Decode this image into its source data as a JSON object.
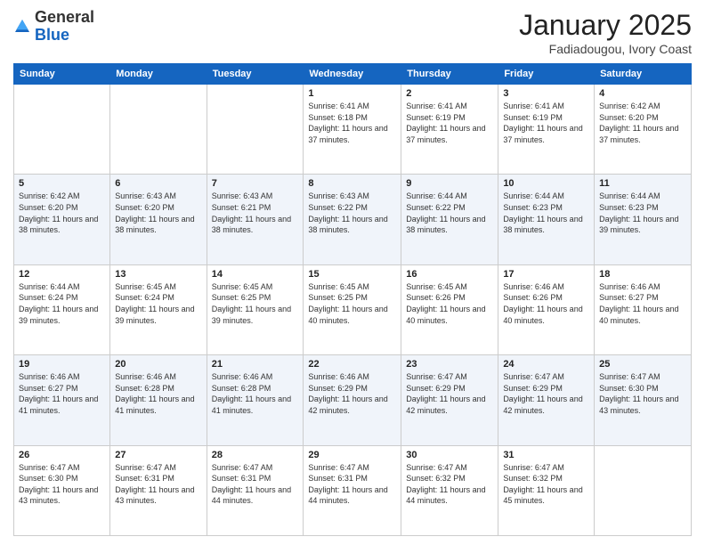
{
  "header": {
    "logo_general": "General",
    "logo_blue": "Blue",
    "month_title": "January 2025",
    "subtitle": "Fadiadougou, Ivory Coast"
  },
  "weekdays": [
    "Sunday",
    "Monday",
    "Tuesday",
    "Wednesday",
    "Thursday",
    "Friday",
    "Saturday"
  ],
  "weeks": [
    [
      {
        "day": "",
        "sunrise": "",
        "sunset": "",
        "daylight": ""
      },
      {
        "day": "",
        "sunrise": "",
        "sunset": "",
        "daylight": ""
      },
      {
        "day": "",
        "sunrise": "",
        "sunset": "",
        "daylight": ""
      },
      {
        "day": "1",
        "sunrise": "Sunrise: 6:41 AM",
        "sunset": "Sunset: 6:18 PM",
        "daylight": "Daylight: 11 hours and 37 minutes."
      },
      {
        "day": "2",
        "sunrise": "Sunrise: 6:41 AM",
        "sunset": "Sunset: 6:19 PM",
        "daylight": "Daylight: 11 hours and 37 minutes."
      },
      {
        "day": "3",
        "sunrise": "Sunrise: 6:41 AM",
        "sunset": "Sunset: 6:19 PM",
        "daylight": "Daylight: 11 hours and 37 minutes."
      },
      {
        "day": "4",
        "sunrise": "Sunrise: 6:42 AM",
        "sunset": "Sunset: 6:20 PM",
        "daylight": "Daylight: 11 hours and 37 minutes."
      }
    ],
    [
      {
        "day": "5",
        "sunrise": "Sunrise: 6:42 AM",
        "sunset": "Sunset: 6:20 PM",
        "daylight": "Daylight: 11 hours and 38 minutes."
      },
      {
        "day": "6",
        "sunrise": "Sunrise: 6:43 AM",
        "sunset": "Sunset: 6:20 PM",
        "daylight": "Daylight: 11 hours and 38 minutes."
      },
      {
        "day": "7",
        "sunrise": "Sunrise: 6:43 AM",
        "sunset": "Sunset: 6:21 PM",
        "daylight": "Daylight: 11 hours and 38 minutes."
      },
      {
        "day": "8",
        "sunrise": "Sunrise: 6:43 AM",
        "sunset": "Sunset: 6:22 PM",
        "daylight": "Daylight: 11 hours and 38 minutes."
      },
      {
        "day": "9",
        "sunrise": "Sunrise: 6:44 AM",
        "sunset": "Sunset: 6:22 PM",
        "daylight": "Daylight: 11 hours and 38 minutes."
      },
      {
        "day": "10",
        "sunrise": "Sunrise: 6:44 AM",
        "sunset": "Sunset: 6:23 PM",
        "daylight": "Daylight: 11 hours and 38 minutes."
      },
      {
        "day": "11",
        "sunrise": "Sunrise: 6:44 AM",
        "sunset": "Sunset: 6:23 PM",
        "daylight": "Daylight: 11 hours and 39 minutes."
      }
    ],
    [
      {
        "day": "12",
        "sunrise": "Sunrise: 6:44 AM",
        "sunset": "Sunset: 6:24 PM",
        "daylight": "Daylight: 11 hours and 39 minutes."
      },
      {
        "day": "13",
        "sunrise": "Sunrise: 6:45 AM",
        "sunset": "Sunset: 6:24 PM",
        "daylight": "Daylight: 11 hours and 39 minutes."
      },
      {
        "day": "14",
        "sunrise": "Sunrise: 6:45 AM",
        "sunset": "Sunset: 6:25 PM",
        "daylight": "Daylight: 11 hours and 39 minutes."
      },
      {
        "day": "15",
        "sunrise": "Sunrise: 6:45 AM",
        "sunset": "Sunset: 6:25 PM",
        "daylight": "Daylight: 11 hours and 40 minutes."
      },
      {
        "day": "16",
        "sunrise": "Sunrise: 6:45 AM",
        "sunset": "Sunset: 6:26 PM",
        "daylight": "Daylight: 11 hours and 40 minutes."
      },
      {
        "day": "17",
        "sunrise": "Sunrise: 6:46 AM",
        "sunset": "Sunset: 6:26 PM",
        "daylight": "Daylight: 11 hours and 40 minutes."
      },
      {
        "day": "18",
        "sunrise": "Sunrise: 6:46 AM",
        "sunset": "Sunset: 6:27 PM",
        "daylight": "Daylight: 11 hours and 40 minutes."
      }
    ],
    [
      {
        "day": "19",
        "sunrise": "Sunrise: 6:46 AM",
        "sunset": "Sunset: 6:27 PM",
        "daylight": "Daylight: 11 hours and 41 minutes."
      },
      {
        "day": "20",
        "sunrise": "Sunrise: 6:46 AM",
        "sunset": "Sunset: 6:28 PM",
        "daylight": "Daylight: 11 hours and 41 minutes."
      },
      {
        "day": "21",
        "sunrise": "Sunrise: 6:46 AM",
        "sunset": "Sunset: 6:28 PM",
        "daylight": "Daylight: 11 hours and 41 minutes."
      },
      {
        "day": "22",
        "sunrise": "Sunrise: 6:46 AM",
        "sunset": "Sunset: 6:29 PM",
        "daylight": "Daylight: 11 hours and 42 minutes."
      },
      {
        "day": "23",
        "sunrise": "Sunrise: 6:47 AM",
        "sunset": "Sunset: 6:29 PM",
        "daylight": "Daylight: 11 hours and 42 minutes."
      },
      {
        "day": "24",
        "sunrise": "Sunrise: 6:47 AM",
        "sunset": "Sunset: 6:29 PM",
        "daylight": "Daylight: 11 hours and 42 minutes."
      },
      {
        "day": "25",
        "sunrise": "Sunrise: 6:47 AM",
        "sunset": "Sunset: 6:30 PM",
        "daylight": "Daylight: 11 hours and 43 minutes."
      }
    ],
    [
      {
        "day": "26",
        "sunrise": "Sunrise: 6:47 AM",
        "sunset": "Sunset: 6:30 PM",
        "daylight": "Daylight: 11 hours and 43 minutes."
      },
      {
        "day": "27",
        "sunrise": "Sunrise: 6:47 AM",
        "sunset": "Sunset: 6:31 PM",
        "daylight": "Daylight: 11 hours and 43 minutes."
      },
      {
        "day": "28",
        "sunrise": "Sunrise: 6:47 AM",
        "sunset": "Sunset: 6:31 PM",
        "daylight": "Daylight: 11 hours and 44 minutes."
      },
      {
        "day": "29",
        "sunrise": "Sunrise: 6:47 AM",
        "sunset": "Sunset: 6:31 PM",
        "daylight": "Daylight: 11 hours and 44 minutes."
      },
      {
        "day": "30",
        "sunrise": "Sunrise: 6:47 AM",
        "sunset": "Sunset: 6:32 PM",
        "daylight": "Daylight: 11 hours and 44 minutes."
      },
      {
        "day": "31",
        "sunrise": "Sunrise: 6:47 AM",
        "sunset": "Sunset: 6:32 PM",
        "daylight": "Daylight: 11 hours and 45 minutes."
      },
      {
        "day": "",
        "sunrise": "",
        "sunset": "",
        "daylight": ""
      }
    ]
  ]
}
